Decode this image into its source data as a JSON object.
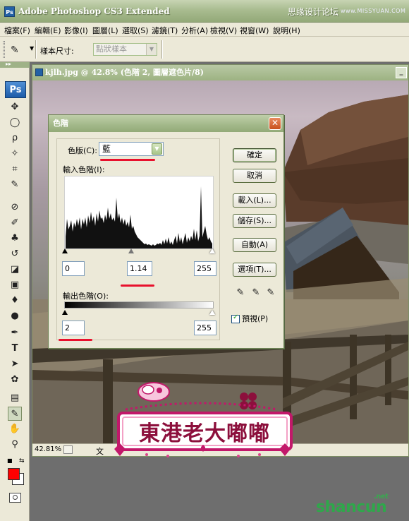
{
  "app": {
    "title": "Adobe Photoshop CS3 Extended",
    "watermark_cn": "思缘设计论坛",
    "watermark_url": "www.MISSYUAN.COM"
  },
  "menu": [
    "檔案(F)",
    "編輯(E)",
    "影像(I)",
    "圖層(L)",
    "選取(S)",
    "濾鏡(T)",
    "分析(A)",
    "檢視(V)",
    "視窗(W)",
    "說明(H)"
  ],
  "options_bar": {
    "sample_size_label": "樣本尺寸:",
    "sample_size_value": "點狀樣本"
  },
  "document": {
    "title": "kjlh.jpg @ 42.8% (色階 2, 圖層遮色片/8)",
    "zoom": "42.81%",
    "status_prefix": "文"
  },
  "dialog": {
    "title": "色階",
    "channel_label": "色版(C):",
    "channel_value": "藍",
    "input_levels_label": "輸入色階(I):",
    "input_black": "0",
    "input_gamma": "1.14",
    "input_white": "255",
    "output_levels_label": "輸出色階(O):",
    "output_black": "2",
    "output_white": "255",
    "buttons": {
      "ok": "確定",
      "cancel": "取消",
      "load": "載入(L)...",
      "save": "儲存(S)...",
      "auto": "自動(A)",
      "options": "選項(T)..."
    },
    "preview_label": "預視(P)",
    "preview_checked": true,
    "annotation_color": "#e8112d"
  },
  "logo_text": "東港老大嘟嘟",
  "site_watermark": {
    "text": "shancun",
    "suffix": ".net"
  },
  "colors": {
    "foreground": "#ff0000",
    "background": "#ffffff",
    "titlebar": "#a9bc90",
    "logo_pink": "#c2186a"
  }
}
